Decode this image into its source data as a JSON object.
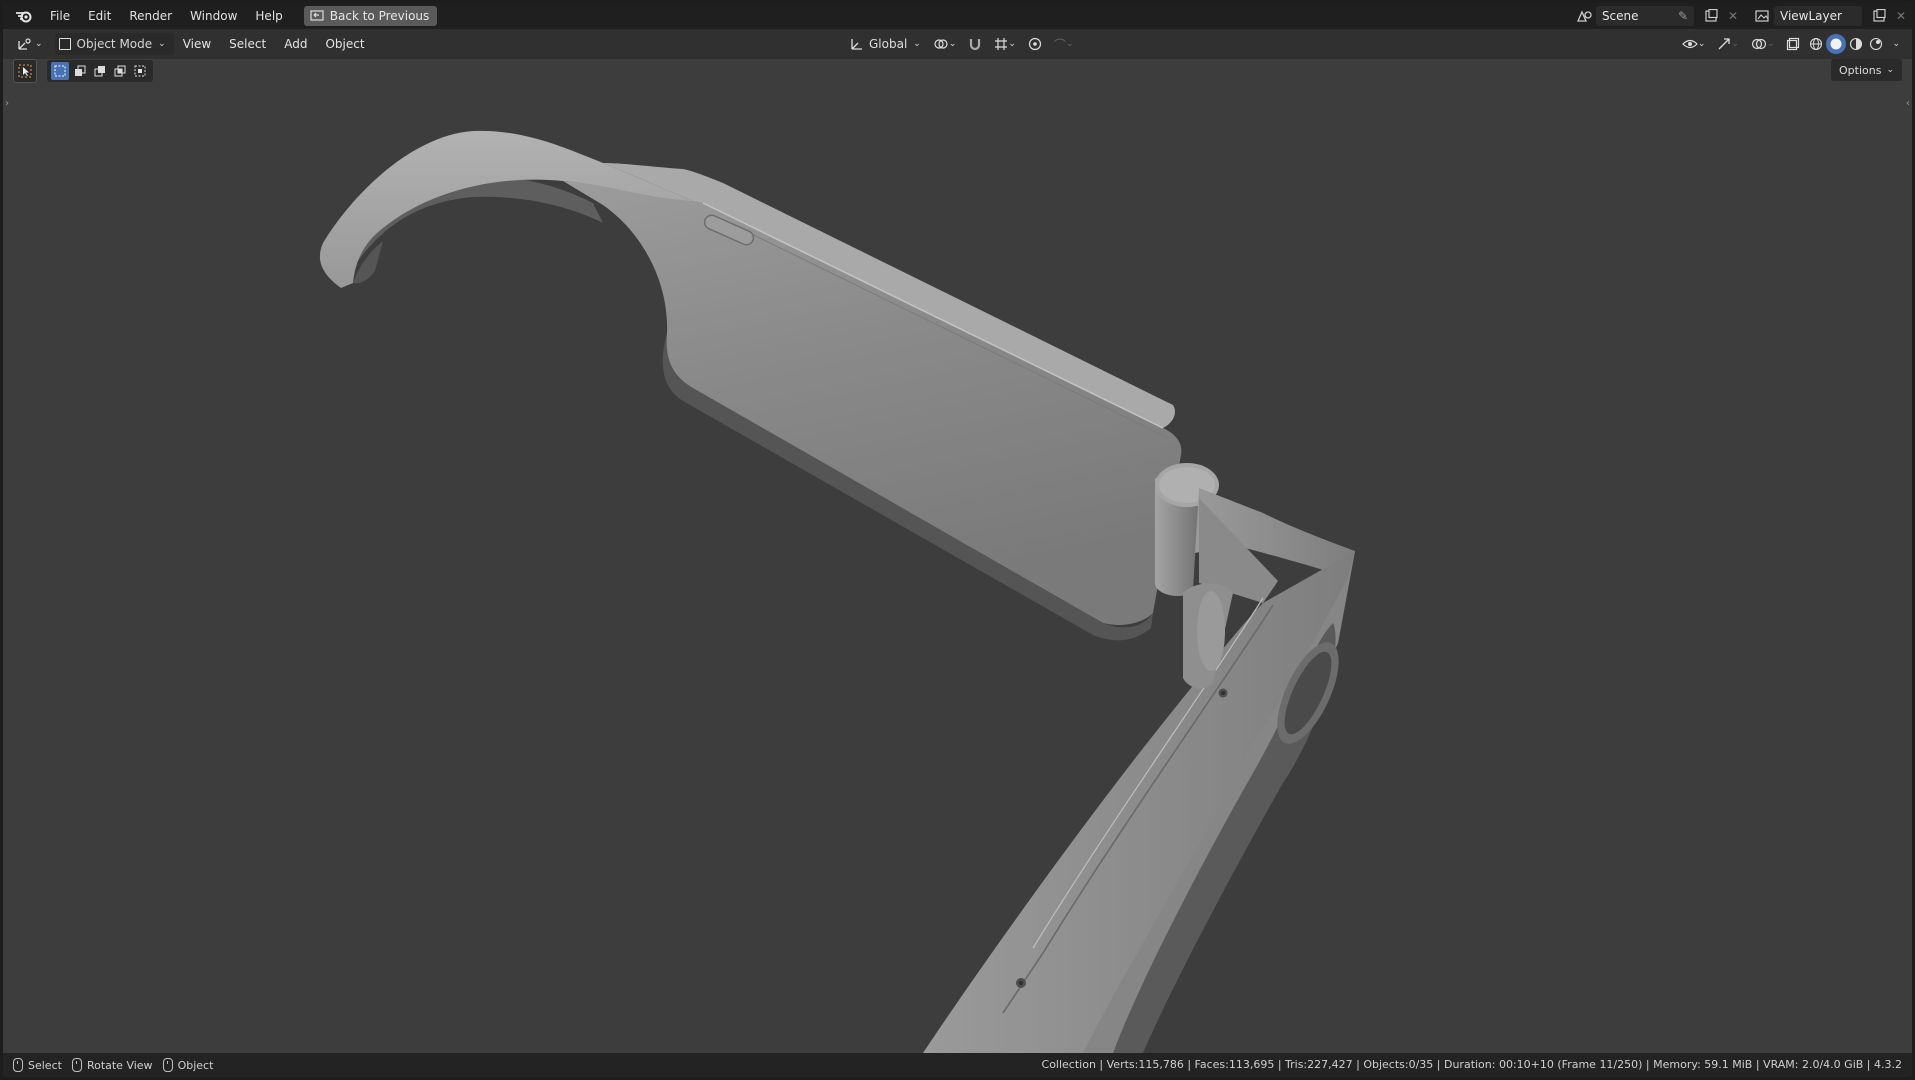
{
  "topbar": {
    "menus": [
      "File",
      "Edit",
      "Render",
      "Window",
      "Help"
    ],
    "back_button": "Back to Previous",
    "scene_name": "Scene",
    "view_layer": "ViewLayer"
  },
  "header": {
    "mode": "Object Mode",
    "menus": [
      "View",
      "Select",
      "Add",
      "Object"
    ],
    "orientation": "Global"
  },
  "toolrow": {
    "options_label": "Options"
  },
  "statusbar": {
    "hints": [
      "Select",
      "Rotate View",
      "Object"
    ],
    "stats": "Collection | Verts:115,786 | Faces:113,695 | Tris:227,427 | Objects:0/35 | Duration: 00:10+10 (Frame 11/250) | Memory: 59.1 MiB | VRAM: 2.0/4.0 GiB | 4.3.2"
  },
  "colors": {
    "viewport_bg": "#3d3d3d",
    "model_gray": "#8e8e8e",
    "accent_blue": "#4772b3"
  }
}
